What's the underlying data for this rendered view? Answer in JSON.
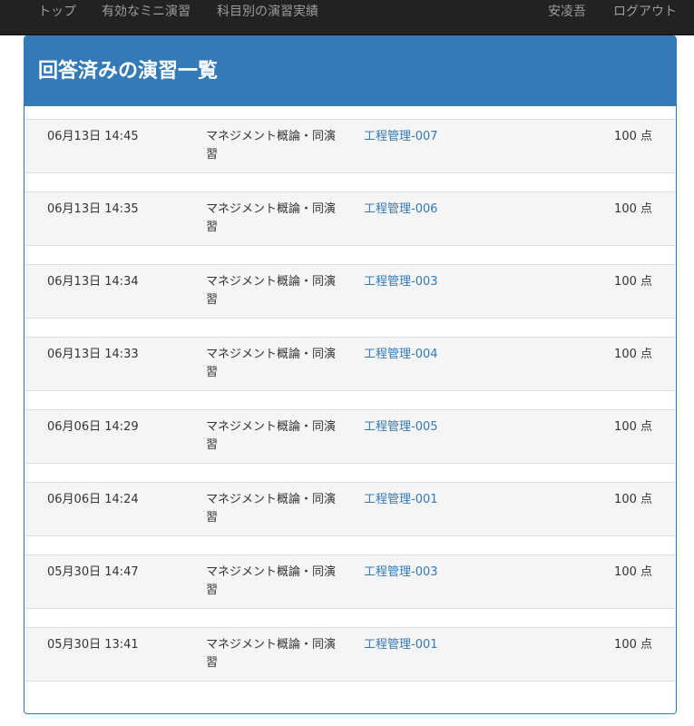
{
  "nav": {
    "top": "トップ",
    "active_drills": "有効なミニ演習",
    "results_by_subject": "科目別の演習実績",
    "user": "安凌吾",
    "logout": "ログアウト"
  },
  "panel": {
    "title": "回答済みの演習一覧"
  },
  "rows": [
    {
      "date": "06月13日 14:45",
      "subject": "マネジメント概論・同演習",
      "exercise": "工程管理-007",
      "score": "100 点"
    },
    {
      "date": "06月13日 14:35",
      "subject": "マネジメント概論・同演習",
      "exercise": "工程管理-006",
      "score": "100 点"
    },
    {
      "date": "06月13日 14:34",
      "subject": "マネジメント概論・同演習",
      "exercise": "工程管理-003",
      "score": "100 点"
    },
    {
      "date": "06月13日 14:33",
      "subject": "マネジメント概論・同演習",
      "exercise": "工程管理-004",
      "score": "100 点"
    },
    {
      "date": "06月06日 14:29",
      "subject": "マネジメント概論・同演習",
      "exercise": "工程管理-005",
      "score": "100 点"
    },
    {
      "date": "06月06日 14:24",
      "subject": "マネジメント概論・同演習",
      "exercise": "工程管理-001",
      "score": "100 点"
    },
    {
      "date": "05月30日 14:47",
      "subject": "マネジメント概論・同演習",
      "exercise": "工程管理-003",
      "score": "100 点"
    },
    {
      "date": "05月30日 13:41",
      "subject": "マネジメント概論・同演習",
      "exercise": "工程管理-001",
      "score": "100 点"
    }
  ]
}
